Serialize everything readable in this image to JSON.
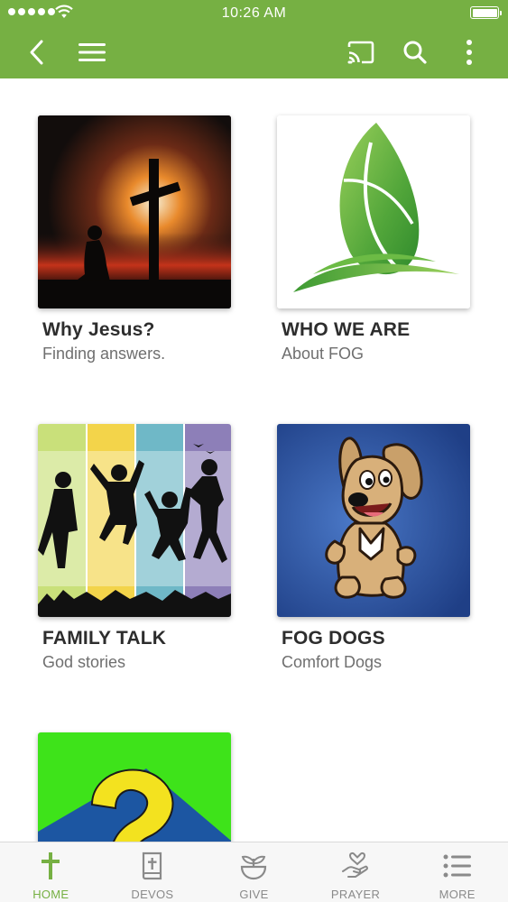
{
  "status_bar": {
    "time": "10:26 AM"
  },
  "app_bar": {
    "back_icon": "chevron-left-icon",
    "menu_icon": "hamburger-menu-icon",
    "cast_icon": "cast-icon",
    "search_icon": "search-icon",
    "more_icon": "more-vertical-icon"
  },
  "tiles": [
    {
      "title": "Why Jesus?",
      "subtitle": "Finding answers.",
      "image": "cross-sunset-image"
    },
    {
      "title": "WHO WE ARE",
      "subtitle": "About FOG",
      "image": "green-leaf-logo"
    },
    {
      "title": "FAMILY TALK",
      "subtitle": "God stories",
      "image": "jumping-silhouettes-image"
    },
    {
      "title": "FOG DOGS",
      "subtitle": "Comfort Dogs",
      "image": "cartoon-dog-image"
    },
    {
      "title": "",
      "subtitle": "",
      "image": "question-mark-image"
    }
  ],
  "bottom_nav": [
    {
      "label": "HOME",
      "icon": "cross-icon",
      "active": true
    },
    {
      "label": "DEVOS",
      "icon": "bible-icon",
      "active": false
    },
    {
      "label": "GIVE",
      "icon": "plant-bowl-icon",
      "active": false
    },
    {
      "label": "PRAYER",
      "icon": "heart-hand-icon",
      "active": false
    },
    {
      "label": "MORE",
      "icon": "list-icon",
      "active": false
    }
  ],
  "colors": {
    "primary": "#76b043",
    "title_text": "#2d2d2d",
    "subtitle_text": "#6f6f6f",
    "nav_inactive": "#8a8a8a"
  }
}
